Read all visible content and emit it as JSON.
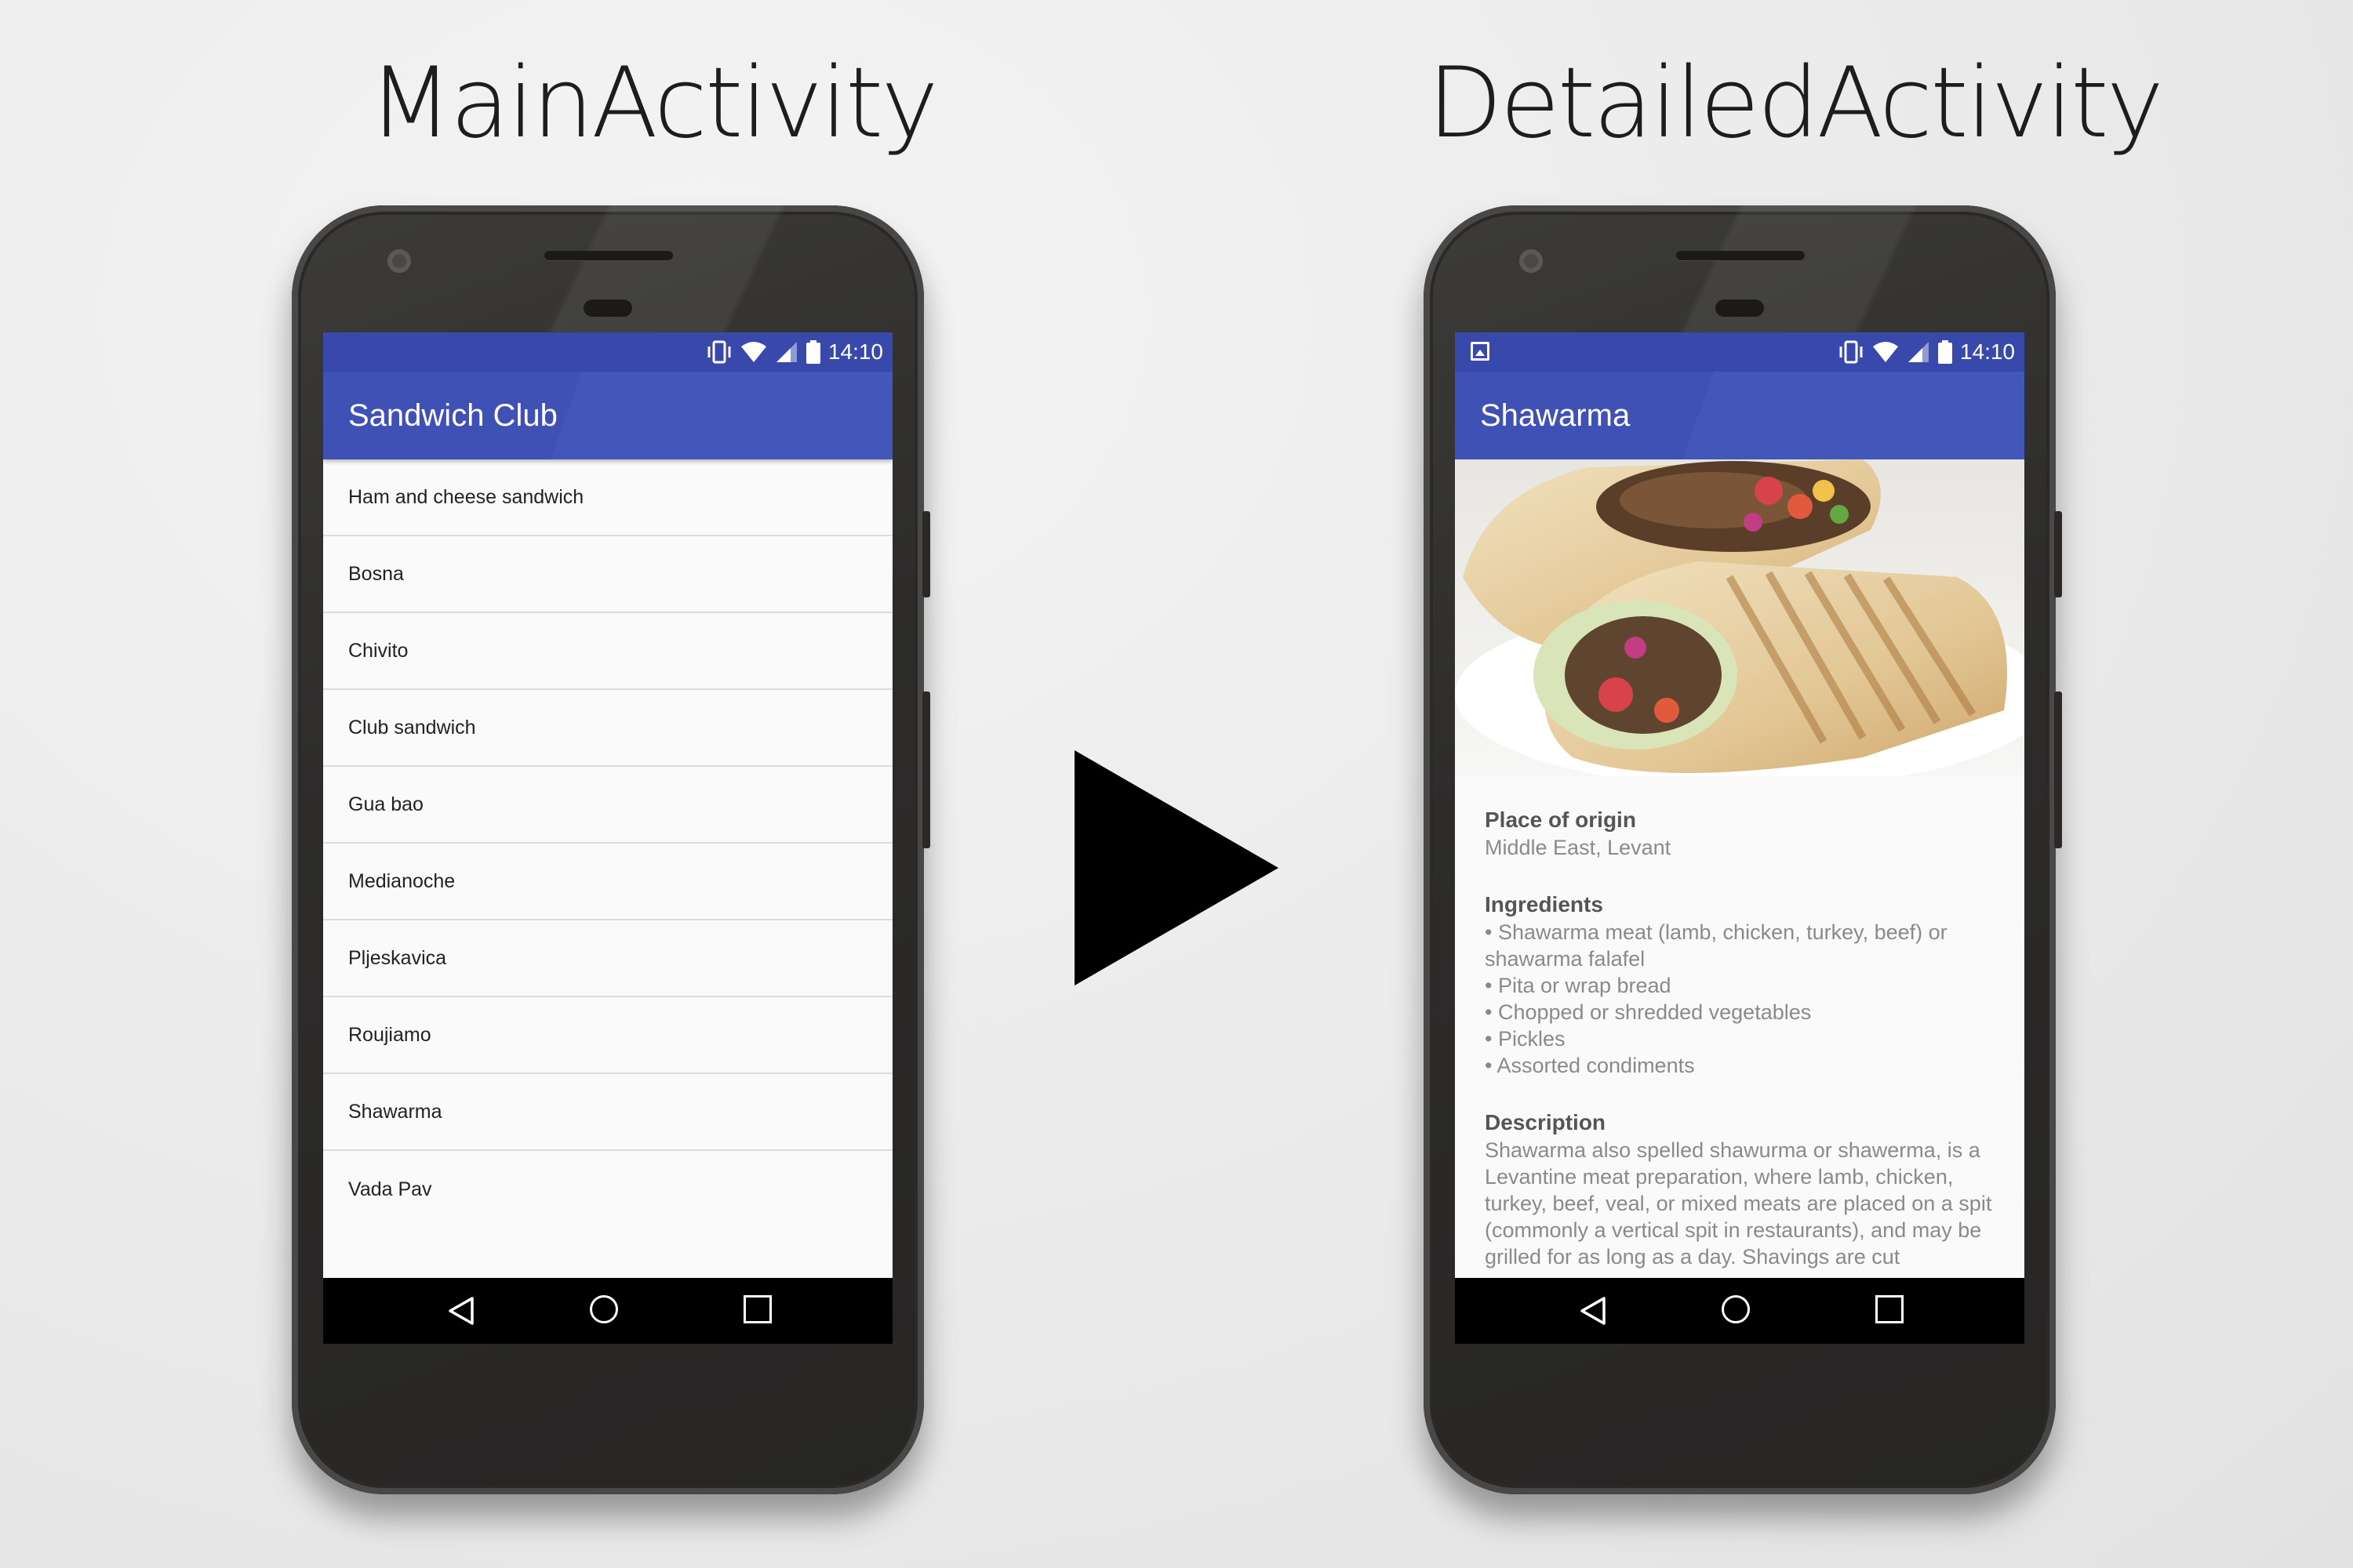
{
  "captions": {
    "left": "MainActivity",
    "right": "DetailedActivity"
  },
  "status_bar": {
    "time": "14:10"
  },
  "main_activity": {
    "app_title": "Sandwich Club",
    "items": [
      {
        "label": "Ham and cheese sandwich"
      },
      {
        "label": "Bosna"
      },
      {
        "label": "Chivito"
      },
      {
        "label": "Club sandwich"
      },
      {
        "label": "Gua bao"
      },
      {
        "label": "Medianoche"
      },
      {
        "label": "Pljeskavica"
      },
      {
        "label": "Roujiamo"
      },
      {
        "label": "Shawarma"
      },
      {
        "label": "Vada Pav"
      }
    ]
  },
  "detailed_activity": {
    "title": "Shawarma",
    "origin_label": "Place of origin",
    "origin_value": "Middle East, Levant",
    "ingredients_label": "Ingredients",
    "ingredients": [
      "• Shawarma meat (lamb, chicken, turkey, beef) or shawarma falafel",
      "• Pita or wrap bread",
      "• Chopped or shredded vegetables",
      "• Pickles",
      "• Assorted condiments"
    ],
    "description_label": "Description",
    "description": "Shawarma also spelled shawurma or shawerma, is a Levantine meat preparation, where lamb, chicken, turkey, beef, veal, or mixed meats are placed on a spit (commonly a vertical spit in restaurants), and may be grilled for as long as a day. Shavings are cut"
  },
  "colors": {
    "primary": "#3f51b5",
    "primary_dark": "#3949ab",
    "nav_bar": "#000000"
  },
  "icons": [
    "vibrate-icon",
    "wifi-icon",
    "signal-icon",
    "battery-icon",
    "notification-image-icon",
    "back-icon",
    "home-icon",
    "recents-icon",
    "play-arrow-icon"
  ]
}
